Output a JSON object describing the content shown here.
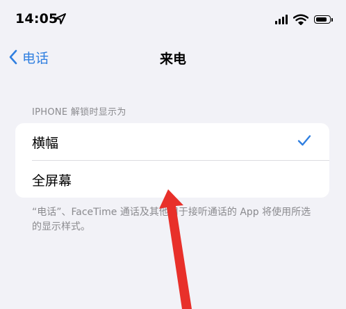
{
  "status_bar": {
    "time": "14:05",
    "location_icon": "location-arrow-icon",
    "signal_icon": "cellular-signal-icon",
    "wifi_icon": "wifi-icon",
    "battery_icon": "battery-icon",
    "battery_level": 0.85
  },
  "nav": {
    "back_label": "电话",
    "back_icon": "chevron-left-icon",
    "title": "来电"
  },
  "section": {
    "header": "IPHONE 解锁时显示为",
    "options": [
      {
        "label": "横幅",
        "selected": true
      },
      {
        "label": "全屏幕",
        "selected": false
      }
    ],
    "footer": "“电话”、FaceTime 通话及其他用于接听通话的 App 将使用所选的显示样式。"
  },
  "colors": {
    "accent": "#2f7fe0",
    "background": "#f2f2f7",
    "secondary_text": "#8a8a8e",
    "annotation": "#e8302a"
  }
}
